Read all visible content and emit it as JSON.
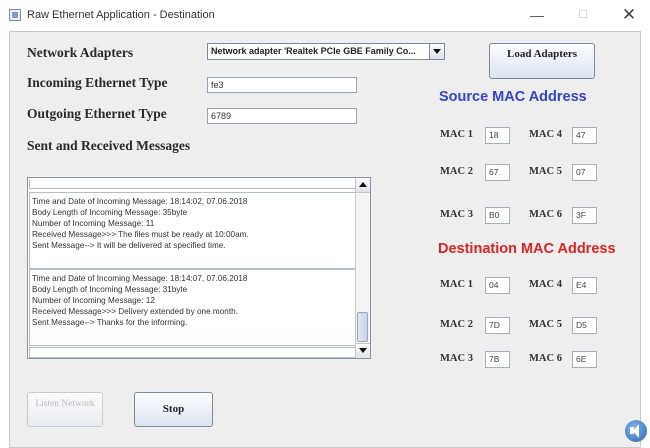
{
  "window": {
    "title": "Raw Ethernet Application - Destination",
    "minimize": "—",
    "maximize": "☐",
    "close": "✕"
  },
  "form": {
    "network_adapters_label": "Network Adapters",
    "adapter_selected": "Network adapter 'Realtek PCIe GBE Family Co...",
    "incoming_type_label": "Incoming Ethernet Type",
    "incoming_type_value": "fe3",
    "outgoing_type_label": "Outgoing Ethernet Type",
    "outgoing_type_value": "6789",
    "messages_label": "Sent and Received Messages"
  },
  "buttons": {
    "load_adapters": "Load Adapters",
    "listen_network": "Listen Network",
    "stop": "Stop"
  },
  "messages": [
    {
      "lines": [
        "Time and Date of Incoming Message: 18:14:02, 07.06.2018",
        "Body Length of Incoming Message: 35byte",
        "Number of Incoming Message: 11",
        "Received Message>>> The files must be ready at 10:00am.",
        "Sent Message--> It will be delivered at specified time."
      ]
    },
    {
      "lines": [
        "Time and Date of Incoming Message: 18:14:07, 07.06.2018",
        "Body Length of Incoming Message: 31byte",
        "Number of Incoming Message: 12",
        "Received Message>>> Delivery extended by one month.",
        "Sent Message--> Thanks for the informing."
      ]
    }
  ],
  "source_mac": {
    "title": "Source MAC Address",
    "color": "#3344cc",
    "fields": [
      {
        "label": "MAC 1",
        "value": "18"
      },
      {
        "label": "MAC 2",
        "value": "67"
      },
      {
        "label": "MAC 3",
        "value": "B0"
      },
      {
        "label": "MAC 4",
        "value": "47"
      },
      {
        "label": "MAC 5",
        "value": "07"
      },
      {
        "label": "MAC 6",
        "value": "3F"
      }
    ]
  },
  "destination_mac": {
    "title": "Destination MAC Address",
    "color": "#dd2222",
    "fields": [
      {
        "label": "MAC 1",
        "value": "04"
      },
      {
        "label": "MAC 2",
        "value": "7D"
      },
      {
        "label": "MAC 3",
        "value": "7B"
      },
      {
        "label": "MAC 4",
        "value": "E4"
      },
      {
        "label": "MAC 5",
        "value": "D5"
      },
      {
        "label": "MAC 6",
        "value": "6E"
      }
    ]
  },
  "icons": {
    "app": "app-window-icon",
    "dropdown": "chevron-down-icon",
    "scroll_up": "arrow-up-icon",
    "scroll_down": "arrow-down-icon",
    "speaker": "speaker-icon"
  }
}
